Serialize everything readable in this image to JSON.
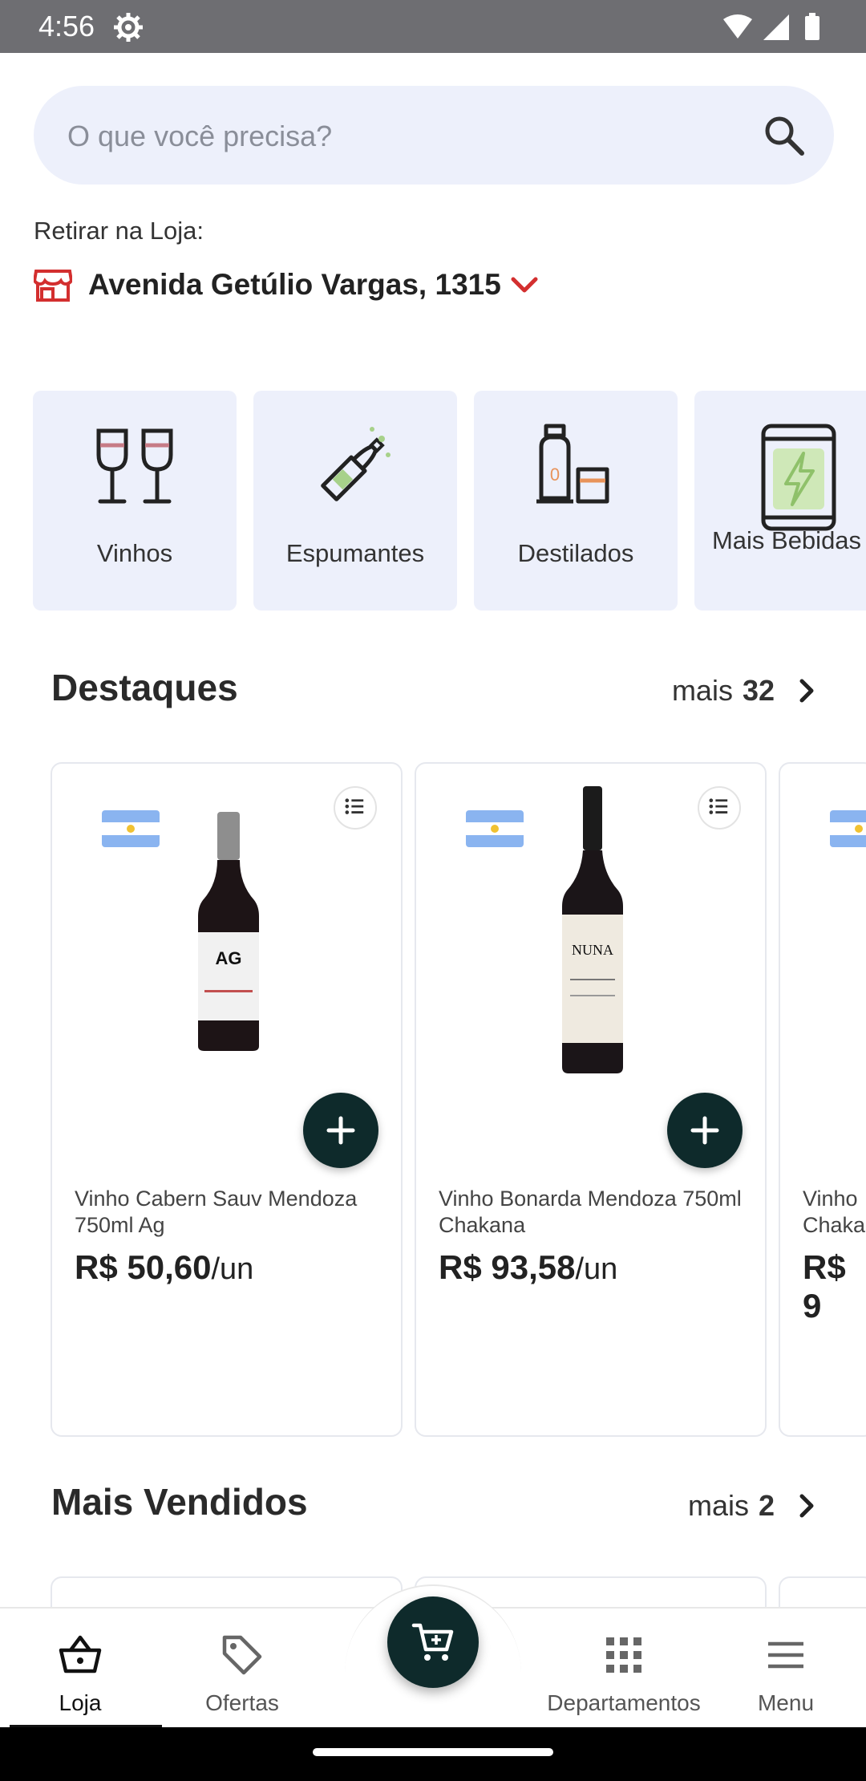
{
  "status_bar": {
    "time": "4:56"
  },
  "search": {
    "placeholder": "O que você precisa?"
  },
  "pickup": {
    "label": "Retirar na Loja:",
    "store": "Avenida Getúlio Vargas, 1315"
  },
  "categories": [
    {
      "label": "Vinhos",
      "icon": "wine-glasses-icon"
    },
    {
      "label": "Espumantes",
      "icon": "champagne-bottle-icon"
    },
    {
      "label": "Destilados",
      "icon": "spirits-icon"
    },
    {
      "label": "Mais Bebidas",
      "icon": "can-icon"
    }
  ],
  "sections": {
    "destaques": {
      "title": "Destaques",
      "more_label": "mais",
      "more_count": "32"
    },
    "mais_vendidos": {
      "title": "Mais Vendidos",
      "more_label": "mais",
      "more_count": "2"
    }
  },
  "products": [
    {
      "name": "Vinho Cabern Sauv Mendoza 750ml Ag",
      "price": "R$ 50,60",
      "unit": "/un",
      "origin": "argentina-flag"
    },
    {
      "name": "Vinho Bonarda Mendoza 750ml Chakana",
      "price": "R$ 93,58",
      "unit": "/un",
      "origin": "argentina-flag"
    },
    {
      "name": "Vinho Chaka",
      "price": "R$ 9",
      "unit": "",
      "origin": "argentina-flag"
    }
  ],
  "bottom_nav": [
    {
      "label": "Loja",
      "icon": "basket-icon",
      "active": true
    },
    {
      "label": "Ofertas",
      "icon": "tag-icon",
      "active": false
    },
    {
      "label": "Departamentos",
      "icon": "grid-icon",
      "active": false
    },
    {
      "label": "Menu",
      "icon": "hamburger-icon",
      "active": false
    }
  ],
  "colors": {
    "accent": "#0e2a2b",
    "store_icon": "#d32f2f",
    "category_bg": "#edf0fb"
  }
}
